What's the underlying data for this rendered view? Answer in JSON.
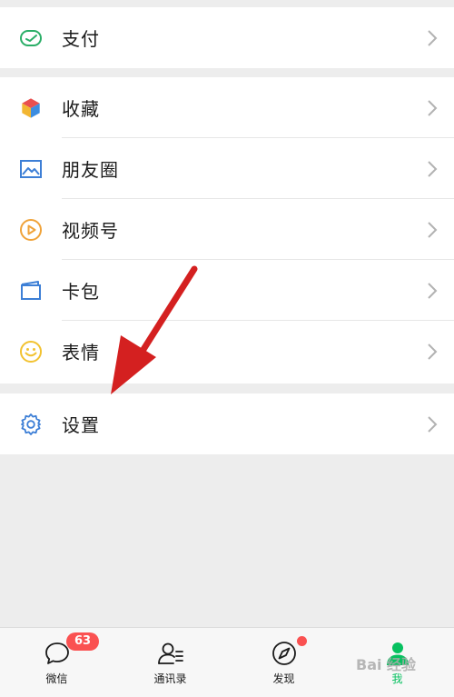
{
  "rows": {
    "pay": {
      "label": "支付",
      "icon": "wallet-icon"
    },
    "favorites": {
      "label": "收藏",
      "icon": "cube-icon"
    },
    "moments": {
      "label": "朋友圈",
      "icon": "image-icon"
    },
    "channels": {
      "label": "视频号",
      "icon": "play-circle-icon"
    },
    "cards": {
      "label": "卡包",
      "icon": "card-wallet-icon"
    },
    "stickers": {
      "label": "表情",
      "icon": "smiley-icon"
    },
    "settings": {
      "label": "设置",
      "icon": "gear-icon"
    }
  },
  "tabbar": {
    "chats": {
      "label": "微信",
      "badge": "63",
      "icon": "chat-bubble-icon"
    },
    "contacts": {
      "label": "通讯录",
      "icon": "contacts-icon"
    },
    "discover": {
      "label": "发现",
      "icon": "compass-icon",
      "has_dot": true
    },
    "me": {
      "label": "我",
      "icon": "person-icon",
      "active": true
    }
  },
  "watermark": {
    "text": "Bai 经验"
  },
  "colors": {
    "accent_green": "#07c160",
    "badge_red": "#fa5151",
    "annotation_arrow": "#d42020",
    "background": "#ededed"
  }
}
